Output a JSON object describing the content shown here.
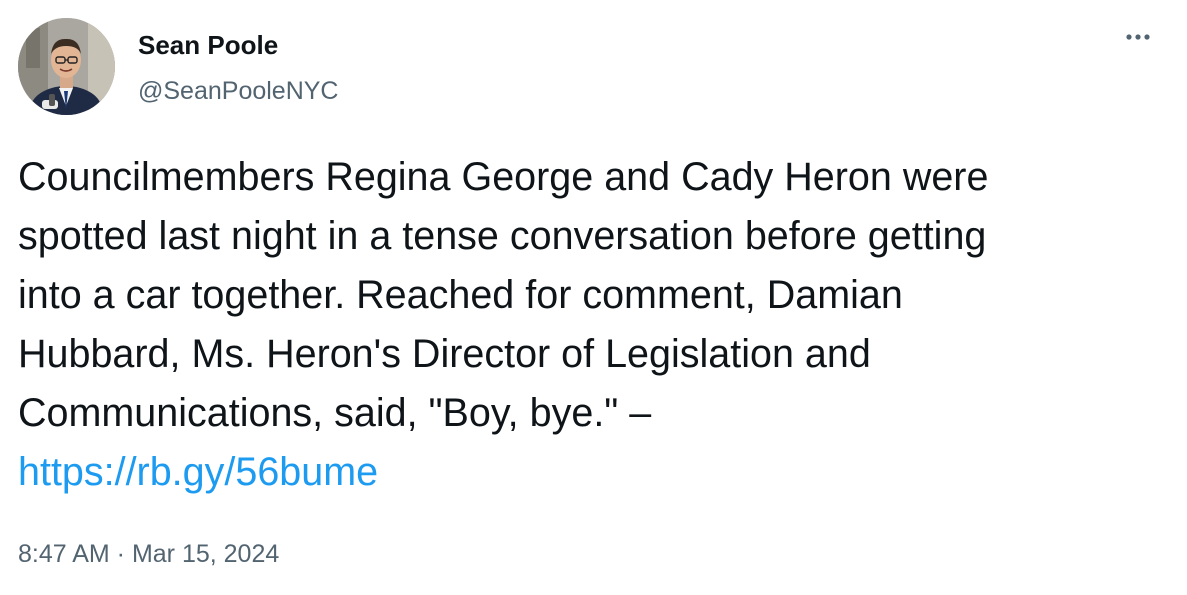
{
  "tweet": {
    "author": {
      "name": "Sean Poole",
      "handle": "@SeanPooleNYC"
    },
    "text": "Councilmembers Regina George and Cady Heron were\nspotted last night in a tense conversation before getting\ninto a car together. Reached for comment, Damian\nHubbard, Ms. Heron's Director of Legislation and\nCommunications, said, \"Boy, bye.\" –\n",
    "link": "https://rb.gy/56bume",
    "time": "8:47 AM",
    "separator": " · ",
    "date": "Mar 15, 2024",
    "more_icon": "more-horizontal-icon"
  },
  "colors": {
    "text": "#0f1419",
    "secondary": "#536471",
    "link": "#1d9bf0",
    "background": "#ffffff"
  }
}
